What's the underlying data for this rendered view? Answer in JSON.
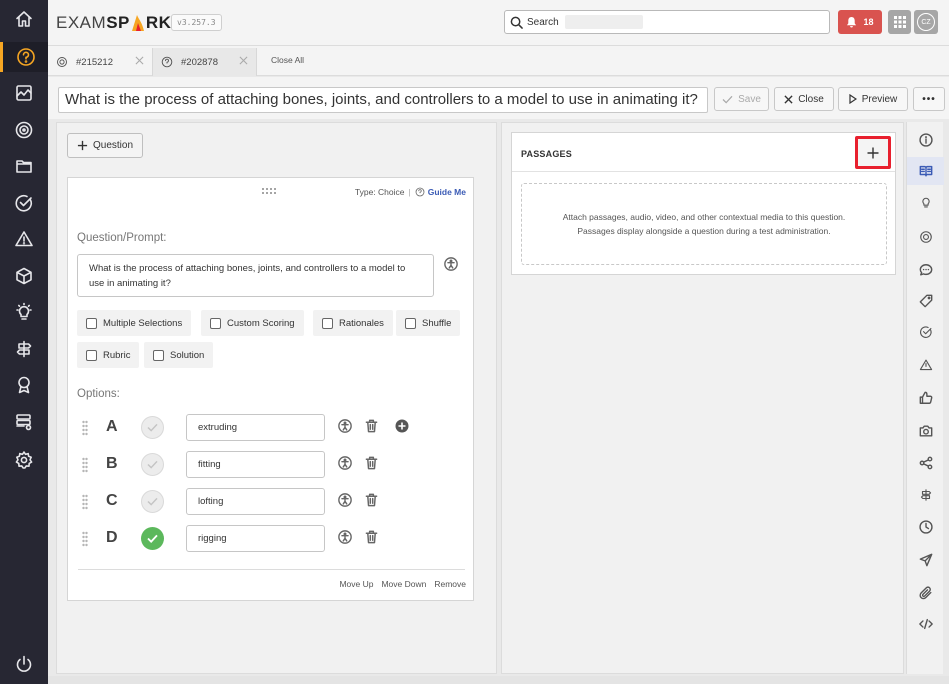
{
  "app": {
    "logo_part1": "EXAM",
    "logo_part2a": "SP",
    "logo_part2b": "RK",
    "version": "v3.257.3",
    "search_label": "Search",
    "notifications_count": "18",
    "avatar_initials": "CZ",
    "accent_color": "#f6a623",
    "alert_color": "#d9534f",
    "highlight_color": "#e8202e"
  },
  "left_nav": [
    {
      "icon": "home-icon"
    },
    {
      "icon": "question-circle-icon",
      "active": true
    },
    {
      "icon": "chart-image-icon"
    },
    {
      "icon": "target-icon"
    },
    {
      "icon": "folder-icon"
    },
    {
      "icon": "check-circle-icon"
    },
    {
      "icon": "warning-icon"
    },
    {
      "icon": "cube-icon"
    },
    {
      "icon": "lightbulb-icon"
    },
    {
      "icon": "signpost-icon"
    },
    {
      "icon": "award-icon"
    },
    {
      "icon": "server-settings-icon"
    },
    {
      "icon": "gear-icon"
    },
    {
      "icon": "power-icon"
    }
  ],
  "tabs": {
    "items": [
      {
        "label": "#215212",
        "icon": "target-icon",
        "active": false
      },
      {
        "label": "#202878",
        "icon": "question-circle-icon",
        "active": true
      }
    ],
    "close_all": "Close All"
  },
  "title_bar": {
    "title": "What is the process of attaching bones, joints, and controllers to a model to use in animating it?",
    "save": "Save",
    "close": "Close",
    "preview": "Preview",
    "more": "•••"
  },
  "editor": {
    "add_question": "Question",
    "type_label": "Type: Choice",
    "separator": "|",
    "guide_me": "Guide Me",
    "prompt_label": "Question/Prompt:",
    "prompt_text": "What is the process of attaching bones, joints, and controllers to a model to use in animating it?",
    "checkboxes": [
      {
        "label": "Multiple Selections",
        "checked": false
      },
      {
        "label": "Custom Scoring",
        "checked": false
      },
      {
        "label": "Rationales",
        "checked": false
      },
      {
        "label": "Shuffle",
        "checked": false
      },
      {
        "label": "Rubric",
        "checked": false
      },
      {
        "label": "Solution",
        "checked": false
      }
    ],
    "options_label": "Options:",
    "options": [
      {
        "letter": "A",
        "value": "extruding",
        "correct": false
      },
      {
        "letter": "B",
        "value": "fitting",
        "correct": false
      },
      {
        "letter": "C",
        "value": "lofting",
        "correct": false
      },
      {
        "letter": "D",
        "value": "rigging",
        "correct": true
      }
    ],
    "footer": {
      "move_up": "Move Up",
      "move_down": "Move Down",
      "remove": "Remove"
    }
  },
  "passages": {
    "title": "PASSAGES",
    "empty_text": "Attach passages, audio, video, and other contextual media to this question. Passages display alongside a question during a test administration."
  },
  "right_strip": [
    {
      "icon": "info-icon"
    },
    {
      "icon": "book-open-icon",
      "active": true
    },
    {
      "icon": "lightbulb-icon"
    },
    {
      "icon": "target-icon"
    },
    {
      "icon": "comment-icon"
    },
    {
      "icon": "tag-icon"
    },
    {
      "icon": "check-circle-icon"
    },
    {
      "icon": "warning-icon"
    },
    {
      "icon": "thumbs-up-icon"
    },
    {
      "icon": "camera-icon"
    },
    {
      "icon": "share-icon"
    },
    {
      "icon": "signpost-icon"
    },
    {
      "icon": "clock-icon"
    },
    {
      "icon": "send-icon"
    },
    {
      "icon": "paperclip-icon"
    },
    {
      "icon": "code-icon"
    }
  ]
}
